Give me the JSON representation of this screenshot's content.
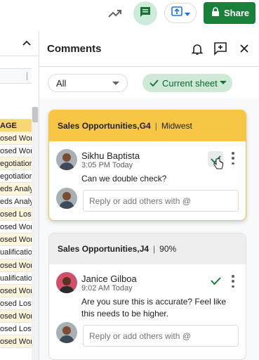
{
  "toolbar": {
    "share_label": "Share",
    "icons": [
      "trending-icon",
      "comment-icon",
      "present-icon",
      "lock-icon"
    ]
  },
  "sheet": {
    "header_cell": "AGE",
    "cells": [
      "osed Wor",
      "osed Wor",
      "egotiatior",
      "egotiatior",
      "eds Analy",
      "eds Analy",
      "osed Lost",
      "osed Wor",
      "osed Wor",
      "ualificatio",
      "osed Wor",
      "ualificatio",
      "osed Wor",
      "osed Lost",
      "osed Wor",
      "osed Lost",
      "osed Wor"
    ],
    "colors": {
      "header": "#fbd679",
      "alt": "#fdf4dc"
    }
  },
  "panel": {
    "title": "Comments",
    "filter_all": "All",
    "filter_sheet": "Current sheet"
  },
  "threads": [
    {
      "ref": "Sales Opportunities,G4",
      "value": "Midwest",
      "author": "Sikhu Baptista",
      "time": "3:05 PM Today",
      "text": "Can we double check?",
      "reply_placeholder": "Reply or add others with @"
    },
    {
      "ref": "Sales Opportunities,J4",
      "value": "90%",
      "author": "Janice Gilboa",
      "time": "9:02 AM Today",
      "text": "Are you sure this is accurate? Feel like this needs to be higher.",
      "reply_placeholder": "Reply or add others with @"
    }
  ],
  "colors": {
    "accent_green": "#188038",
    "active_header": "#f6c644",
    "chip_green": "#ceead6"
  }
}
